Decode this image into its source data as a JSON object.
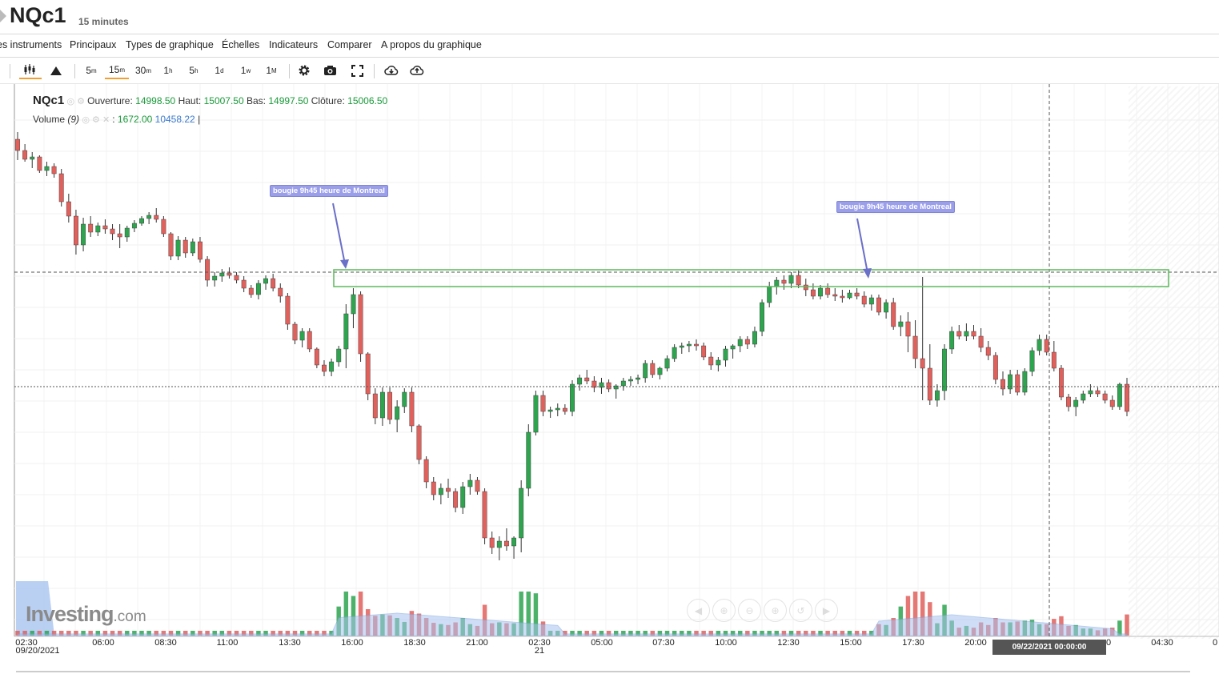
{
  "header": {
    "symbol": "NQc1",
    "interval": "15 minutes"
  },
  "menu": [
    "es instruments",
    "Principaux",
    "Types de graphique",
    "Échelles",
    "Indicateurs",
    "Comparer",
    "A propos du graphique"
  ],
  "toolbar": {
    "periods": [
      {
        "num": "5",
        "unit": "m"
      },
      {
        "num": "15",
        "unit": "m"
      },
      {
        "num": "30",
        "unit": "m"
      },
      {
        "num": "1",
        "unit": "h"
      },
      {
        "num": "5",
        "unit": "h"
      },
      {
        "num": "1",
        "unit": "d"
      },
      {
        "num": "1",
        "unit": "w"
      },
      {
        "num": "1",
        "unit": "M"
      }
    ],
    "active_period": "15m",
    "icons": [
      "candlestick-icon",
      "mountain-icon",
      "settings-gear-icon",
      "camera-icon",
      "fullscreen-icon",
      "cloud-download-icon",
      "cloud-upload-icon"
    ]
  },
  "legend": {
    "symbol": "NQc1",
    "open_label": "Ouverture:",
    "open": "14998.50",
    "high_label": "Haut:",
    "high": "15007.50",
    "low_label": "Bas:",
    "low": "14997.50",
    "close_label": "Clôture:",
    "close": "15006.50",
    "volume_label": "Volume",
    "volume_period": "(9)",
    "volume_value": "1672.00",
    "volume_avg": "10458.22",
    "volume_cursor": "|"
  },
  "annotations": [
    {
      "text": "bougie 9h45 heure de Montreal"
    },
    {
      "text": "bougie 9h45 heure de Montreal"
    }
  ],
  "crosshair_date": "09/22/2021 00:00:00",
  "logo": {
    "brand": "Investing",
    "suffix": ".com"
  },
  "colors": {
    "up": "#2ea44f",
    "down": "#e0605c",
    "volume_area": "#a8c4f0",
    "zone_box": "#5cb85c",
    "annotation": "#9b9fea",
    "accent": "#f0a030"
  },
  "chart_data": {
    "type": "candlestick",
    "title": "NQc1",
    "interval": "15 minutes",
    "x_tick_labels": [
      "02:30",
      "06:00",
      "08:30",
      "11:00",
      "13:30",
      "16:00",
      "18:30",
      "21:00",
      "02:30",
      "05:00",
      "07:30",
      "10:00",
      "12:30",
      "15:00",
      "17:30",
      "20:00",
      "0",
      "04:30",
      "0"
    ],
    "x_sub_labels": [
      "09/20/2021",
      "21"
    ],
    "price_low_shown": 14520,
    "price_high_shown": 15110,
    "candles": [
      [
        15046,
        15055,
        15020,
        15032
      ],
      [
        15032,
        15040,
        15018,
        15021
      ],
      [
        15021,
        15030,
        15010,
        15024
      ],
      [
        15024,
        15026,
        15004,
        15007
      ],
      [
        15007,
        15018,
        15000,
        15012
      ],
      [
        15012,
        15016,
        14998,
        15003
      ],
      [
        15003,
        15009,
        14962,
        14968
      ],
      [
        14968,
        14978,
        14942,
        14950
      ],
      [
        14950,
        14958,
        14902,
        14914
      ],
      [
        14914,
        14948,
        14906,
        14940
      ],
      [
        14940,
        14950,
        14924,
        14930
      ],
      [
        14930,
        14942,
        14925,
        14938
      ],
      [
        14938,
        14946,
        14928,
        14934
      ],
      [
        14934,
        14940,
        14920,
        14928
      ],
      [
        14928,
        14940,
        14910,
        14924
      ],
      [
        14924,
        14938,
        14918,
        14935
      ],
      [
        14935,
        14945,
        14930,
        14941
      ],
      [
        14941,
        14950,
        14938,
        14947
      ],
      [
        14947,
        14955,
        14940,
        14951
      ],
      [
        14951,
        14960,
        14942,
        14946
      ],
      [
        14946,
        14950,
        14924,
        14928
      ],
      [
        14928,
        14930,
        14895,
        14900
      ],
      [
        14900,
        14925,
        14895,
        14920
      ],
      [
        14920,
        14924,
        14898,
        14904
      ],
      [
        14904,
        14922,
        14900,
        14918
      ],
      [
        14918,
        14924,
        14892,
        14896
      ],
      [
        14896,
        14900,
        14862,
        14870
      ],
      [
        14870,
        14880,
        14862,
        14875
      ],
      [
        14875,
        14884,
        14868,
        14879
      ],
      [
        14879,
        14886,
        14872,
        14876
      ],
      [
        14876,
        14880,
        14866,
        14870
      ],
      [
        14870,
        14875,
        14855,
        14860
      ],
      [
        14860,
        14864,
        14848,
        14852
      ],
      [
        14852,
        14870,
        14846,
        14866
      ],
      [
        14866,
        14876,
        14858,
        14872
      ],
      [
        14872,
        14878,
        14856,
        14860
      ],
      [
        14860,
        14866,
        14842,
        14850
      ],
      [
        14850,
        14854,
        14808,
        14815
      ],
      [
        14815,
        14818,
        14790,
        14795
      ],
      [
        14795,
        14810,
        14786,
        14806
      ],
      [
        14806,
        14810,
        14780,
        14784
      ],
      [
        14784,
        14786,
        14760,
        14764
      ],
      [
        14764,
        14770,
        14750,
        14756
      ],
      [
        14756,
        14772,
        14750,
        14768
      ],
      [
        14768,
        14788,
        14762,
        14784
      ],
      [
        14784,
        14840,
        14760,
        14828
      ],
      [
        14828,
        14860,
        14810,
        14852
      ],
      [
        14852,
        14856,
        14768,
        14778
      ],
      [
        14778,
        14780,
        14720,
        14728
      ],
      [
        14728,
        14735,
        14690,
        14698
      ],
      [
        14698,
        14736,
        14688,
        14730
      ],
      [
        14730,
        14736,
        14690,
        14696
      ],
      [
        14696,
        14720,
        14680,
        14712
      ],
      [
        14712,
        14735,
        14704,
        14730
      ],
      [
        14730,
        14736,
        14680,
        14688
      ],
      [
        14688,
        14690,
        14640,
        14646
      ],
      [
        14646,
        14650,
        14610,
        14618
      ],
      [
        14618,
        14624,
        14595,
        14602
      ],
      [
        14602,
        14616,
        14590,
        14610
      ],
      [
        14610,
        14622,
        14598,
        14606
      ],
      [
        14606,
        14610,
        14580,
        14586
      ],
      [
        14586,
        14618,
        14578,
        14612
      ],
      [
        14612,
        14628,
        14602,
        14620
      ],
      [
        14620,
        14624,
        14602,
        14606
      ],
      [
        14606,
        14610,
        14540,
        14548
      ],
      [
        14548,
        14556,
        14528,
        14536
      ],
      [
        14536,
        14550,
        14520,
        14544
      ],
      [
        14544,
        14560,
        14532,
        14538
      ],
      [
        14538,
        14550,
        14522,
        14548
      ],
      [
        14548,
        14620,
        14530,
        14610
      ],
      [
        14610,
        14690,
        14600,
        14680
      ],
      [
        14680,
        14732,
        14676,
        14726
      ],
      [
        14726,
        14732,
        14700,
        14706
      ],
      [
        14706,
        14712,
        14698,
        14708
      ],
      [
        14708,
        14716,
        14700,
        14710
      ],
      [
        14710,
        14715,
        14702,
        14706
      ],
      [
        14706,
        14745,
        14700,
        14740
      ],
      [
        14740,
        14752,
        14732,
        14748
      ],
      [
        14748,
        14758,
        14740,
        14744
      ],
      [
        14744,
        14750,
        14730,
        14736
      ],
      [
        14736,
        14748,
        14728,
        14742
      ],
      [
        14742,
        14746,
        14730,
        14734
      ],
      [
        14734,
        14740,
        14722,
        14738
      ],
      [
        14738,
        14748,
        14732,
        14744
      ],
      [
        14744,
        14750,
        14738,
        14746
      ],
      [
        14746,
        14752,
        14740,
        14748
      ],
      [
        14748,
        14770,
        14742,
        14766
      ],
      [
        14766,
        14770,
        14748,
        14752
      ],
      [
        14752,
        14762,
        14746,
        14760
      ],
      [
        14760,
        14776,
        14756,
        14772
      ],
      [
        14772,
        14790,
        14768,
        14786
      ],
      [
        14786,
        14792,
        14778,
        14788
      ],
      [
        14788,
        14794,
        14780,
        14790
      ],
      [
        14790,
        14796,
        14782,
        14788
      ],
      [
        14788,
        14792,
        14770,
        14774
      ],
      [
        14774,
        14780,
        14758,
        14764
      ],
      [
        14764,
        14774,
        14756,
        14770
      ],
      [
        14770,
        14788,
        14762,
        14784
      ],
      [
        14784,
        14790,
        14772,
        14788
      ],
      [
        14788,
        14800,
        14780,
        14796
      ],
      [
        14796,
        14800,
        14784,
        14790
      ],
      [
        14790,
        14812,
        14786,
        14806
      ],
      [
        14806,
        14846,
        14800,
        14842
      ],
      [
        14842,
        14868,
        14836,
        14862
      ],
      [
        14862,
        14874,
        14852,
        14870
      ],
      [
        14870,
        14876,
        14858,
        14866
      ],
      [
        14866,
        14880,
        14860,
        14876
      ],
      [
        14876,
        14882,
        14860,
        14864
      ],
      [
        14864,
        14872,
        14850,
        14858
      ],
      [
        14858,
        14866,
        14846,
        14850
      ],
      [
        14850,
        14864,
        14846,
        14860
      ],
      [
        14860,
        14866,
        14848,
        14852
      ],
      [
        14852,
        14860,
        14844,
        14850
      ],
      [
        14850,
        14858,
        14842,
        14848
      ],
      [
        14848,
        14858,
        14846,
        14854
      ],
      [
        14854,
        14860,
        14846,
        14850
      ],
      [
        14850,
        14856,
        14836,
        14840
      ],
      [
        14840,
        14852,
        14832,
        14848
      ],
      [
        14848,
        14852,
        14826,
        14830
      ],
      [
        14830,
        14846,
        14822,
        14842
      ],
      [
        14842,
        14848,
        14808,
        14812
      ],
      [
        14812,
        14826,
        14800,
        14818
      ],
      [
        14818,
        14830,
        14780,
        14800
      ],
      [
        14800,
        14820,
        14760,
        14772
      ],
      [
        14772,
        14874,
        14720,
        14760
      ],
      [
        14760,
        14790,
        14714,
        14720
      ],
      [
        14720,
        14740,
        14712,
        14732
      ],
      [
        14732,
        14790,
        14720,
        14784
      ],
      [
        14784,
        14812,
        14778,
        14806
      ],
      [
        14806,
        14814,
        14796,
        14800
      ],
      [
        14800,
        14816,
        14794,
        14806
      ],
      [
        14806,
        14814,
        14796,
        14800
      ],
      [
        14800,
        14810,
        14780,
        14786
      ],
      [
        14786,
        14794,
        14770,
        14776
      ],
      [
        14776,
        14780,
        14740,
        14746
      ],
      [
        14746,
        14756,
        14726,
        14734
      ],
      [
        14734,
        14758,
        14728,
        14752
      ],
      [
        14752,
        14758,
        14726,
        14730
      ],
      [
        14730,
        14760,
        14726,
        14756
      ],
      [
        14756,
        14786,
        14750,
        14782
      ],
      [
        14782,
        14802,
        14776,
        14796
      ],
      [
        14796,
        14802,
        14776,
        14780
      ],
      [
        14780,
        14794,
        14756,
        14760
      ],
      [
        14760,
        14764,
        14720,
        14724
      ],
      [
        14724,
        14728,
        14706,
        14712
      ],
      [
        14712,
        14724,
        14700,
        14720
      ],
      [
        14720,
        14732,
        14716,
        14728
      ],
      [
        14728,
        14740,
        14724,
        14732
      ],
      [
        14732,
        14736,
        14724,
        14728
      ],
      [
        14728,
        14732,
        14716,
        14720
      ],
      [
        14720,
        14726,
        14708,
        14712
      ],
      [
        14712,
        14742,
        14708,
        14740
      ],
      [
        14740,
        14748,
        14700,
        14706
      ]
    ]
  }
}
